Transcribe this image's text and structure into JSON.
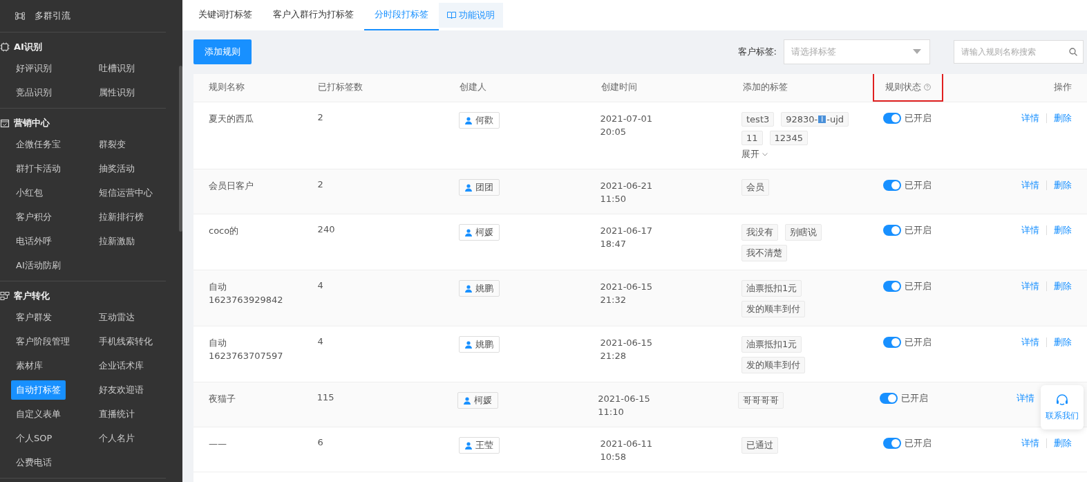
{
  "sidebar": {
    "top_item": "多群引流",
    "sections": [
      {
        "title": "AI识别",
        "items": [
          {
            "label": "好评识别",
            "selected": false
          },
          {
            "label": "吐槽识别",
            "selected": false
          },
          {
            "label": "竞品识别",
            "selected": false
          },
          {
            "label": "属性识别",
            "selected": false
          }
        ]
      },
      {
        "title": "营销中心",
        "items": [
          {
            "label": "企微任务宝",
            "selected": false
          },
          {
            "label": "群裂变",
            "selected": false
          },
          {
            "label": "群打卡活动",
            "selected": false
          },
          {
            "label": "抽奖活动",
            "selected": false
          },
          {
            "label": "小红包",
            "selected": false
          },
          {
            "label": "短信运营中心",
            "selected": false
          },
          {
            "label": "客户积分",
            "selected": false
          },
          {
            "label": "拉新排行榜",
            "selected": false
          },
          {
            "label": "电话外呼",
            "selected": false
          },
          {
            "label": "拉新激励",
            "selected": false
          },
          {
            "label": "AI活动防刷",
            "selected": false
          }
        ]
      },
      {
        "title": "客户转化",
        "items": [
          {
            "label": "客户群发",
            "selected": false
          },
          {
            "label": "互动雷达",
            "selected": false
          },
          {
            "label": "客户阶段管理",
            "selected": false
          },
          {
            "label": "手机线索转化",
            "selected": false
          },
          {
            "label": "素材库",
            "selected": false
          },
          {
            "label": "企业话术库",
            "selected": false
          },
          {
            "label": "自动打标签",
            "selected": true
          },
          {
            "label": "好友欢迎语",
            "selected": false
          },
          {
            "label": "自定义表单",
            "selected": false
          },
          {
            "label": "直播统计",
            "selected": false
          },
          {
            "label": "个人SOP",
            "selected": false
          },
          {
            "label": "个人名片",
            "selected": false
          },
          {
            "label": "公费电话",
            "selected": false
          }
        ]
      }
    ]
  },
  "tabs": [
    {
      "label": "关键词打标签",
      "selected": false
    },
    {
      "label": "客户入群行为打标签",
      "selected": false
    },
    {
      "label": "分时段打标签",
      "selected": true
    }
  ],
  "help_tab": "功能说明",
  "toolbar": {
    "add_button": "添加规则",
    "tag_filter_label": "客户标签:",
    "tag_filter_placeholder": "请选择标签",
    "search_placeholder": "请输入规则名称搜索"
  },
  "table": {
    "columns": [
      {
        "label": "规则名称",
        "highlighted": false,
        "help": false
      },
      {
        "label": "已打标签数",
        "highlighted": false,
        "help": false
      },
      {
        "label": "创建人",
        "highlighted": false,
        "help": false
      },
      {
        "label": "创建时间",
        "highlighted": false,
        "help": false
      },
      {
        "label": "添加的标签",
        "highlighted": false,
        "help": false
      },
      {
        "label": "规则状态",
        "highlighted": true,
        "help": true
      },
      {
        "label": "操作",
        "highlighted": false,
        "help": false
      }
    ],
    "rows": [
      {
        "name": [
          "夏天的西瓜"
        ],
        "count": "2",
        "creator": "何歡",
        "date": "2021-07-01",
        "time": "20:05",
        "tags": [
          {
            "text": "test3"
          },
          {
            "text": "92830-",
            "badge": "I",
            "suffix": "-ujd"
          },
          {
            "text": "11"
          },
          {
            "text": "12345"
          }
        ],
        "expand": "展开",
        "status_on": true,
        "status": "已开启",
        "actions": [
          "详情",
          "删除"
        ]
      },
      {
        "name": [
          "会员日客户"
        ],
        "count": "2",
        "creator": "团团",
        "date": "2021-06-21",
        "time": "11:50",
        "tags": [
          {
            "text": "会员"
          }
        ],
        "status_on": true,
        "status": "已开启",
        "actions": [
          "详情",
          "删除"
        ]
      },
      {
        "name": [
          "coco的"
        ],
        "count": "240",
        "creator": "柯媛",
        "date": "2021-06-17",
        "time": "18:47",
        "tags": [
          {
            "text": "我没有"
          },
          {
            "text": "别瞎说"
          },
          {
            "text": "我不清楚"
          }
        ],
        "status_on": true,
        "status": "已开启",
        "actions": [
          "详情",
          "删除"
        ]
      },
      {
        "name": [
          "自动",
          "1623763929842"
        ],
        "count": "4",
        "creator": "姚鹏",
        "date": "2021-06-15",
        "time": "21:32",
        "tags": [
          {
            "text": "油票抵扣1元"
          },
          {
            "text": "发的顺丰到付"
          }
        ],
        "status_on": true,
        "status": "已开启",
        "actions": [
          "详情",
          "删除"
        ]
      },
      {
        "name": [
          "自动",
          "1623763707597"
        ],
        "count": "4",
        "creator": "姚鹏",
        "date": "2021-06-15",
        "time": "21:28",
        "tags": [
          {
            "text": "油票抵扣1元"
          },
          {
            "text": "发的顺丰到付"
          }
        ],
        "status_on": true,
        "status": "已开启",
        "actions": [
          "详情",
          "删除"
        ]
      },
      {
        "name": [
          "夜猫子"
        ],
        "count": "115",
        "creator": "柯媛",
        "date": "2021-06-15",
        "time": "11:10",
        "tags": [
          {
            "text": "哥哥哥哥"
          }
        ],
        "status_on": true,
        "status": "已开启",
        "actions": [
          "详情"
        ]
      },
      {
        "name": [
          "——"
        ],
        "count": "6",
        "creator": "王莹",
        "date": "2021-06-11",
        "time": "10:58",
        "tags": [
          {
            "text": "已通过"
          }
        ],
        "status_on": true,
        "status": "已开启",
        "actions": [
          "详情",
          "删除"
        ]
      }
    ]
  },
  "contact_button": "联系我们"
}
